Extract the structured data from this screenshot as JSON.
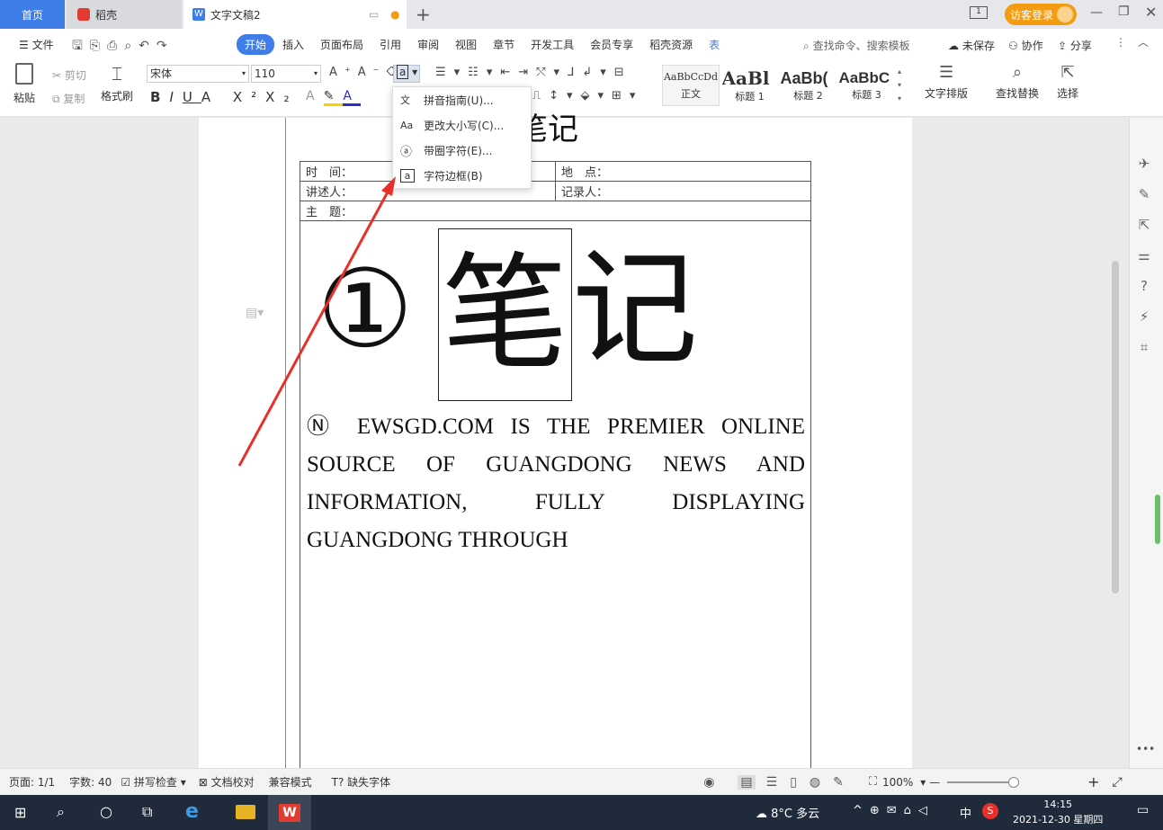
{
  "tabs": {
    "home": "首页",
    "daoke": "稻壳",
    "doc": "文字文稿2"
  },
  "titlebar": {
    "login": "访客登录"
  },
  "menu": {
    "file": "文件",
    "items": [
      "开始",
      "插入",
      "页面布局",
      "引用",
      "审阅",
      "视图",
      "章节",
      "开发工具",
      "会员专享",
      "稻壳资源",
      "表"
    ],
    "search": "查找命令、搜索模板",
    "unsaved": "未保存",
    "collab": "协作",
    "share": "分享"
  },
  "toolbar": {
    "paste": "粘贴",
    "cut": "剪切",
    "copy": "复制",
    "format_painter": "格式刷",
    "font": "宋体",
    "size": "110",
    "text_layout": "文字排版",
    "find_replace": "查找替换",
    "select": "选择"
  },
  "styles": [
    {
      "preview": "AaBbCcDd",
      "name": "正文"
    },
    {
      "preview": "AaBl",
      "name": "标题 1"
    },
    {
      "preview": "AaBb(",
      "name": "标题 2"
    },
    {
      "preview": "AaBbC",
      "name": "标题 3"
    }
  ],
  "dropdown": {
    "items": [
      "拼音指南(U)...",
      "更改大小写(C)...",
      "带圈字符(E)...",
      "字符边框(B)"
    ]
  },
  "document": {
    "title_partial": "笔记",
    "time_label": "时　间：",
    "place_label": "地　点：",
    "speaker_label": "讲述人：",
    "recorder_label": "记录人：",
    "topic_label": "主　题：",
    "circled": "①",
    "bordered_char": "笔",
    "char2": "记",
    "body": "Ⓝ EWSGD.COM IS THE PREMIER ONLINE SOURCE OF GUANGDONG NEWS AND INFORMATION, FULLY DISPLAYING GUANGDONG THROUGH"
  },
  "status": {
    "page": "页面: 1/1",
    "words": "字数: 40",
    "spell": "拼写检查",
    "proof": "文档校对",
    "compat": "兼容模式",
    "missing_font": "缺失字体",
    "zoom": "100%"
  },
  "taskbar": {
    "weather": "8°C 多云",
    "ime": "中",
    "time": "14:15",
    "date": "2021-12-30 星期四"
  },
  "colors": {
    "accent": "#3f7ee8",
    "arrow": "#e8302a",
    "login": "#f39c12"
  }
}
